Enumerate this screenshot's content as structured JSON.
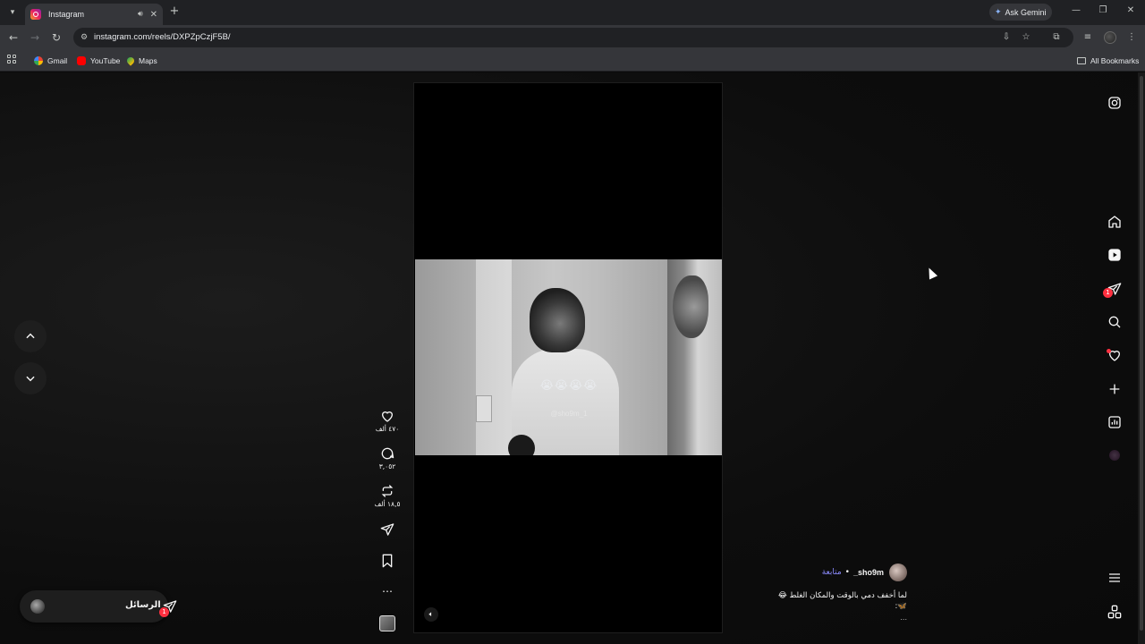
{
  "browser": {
    "tab": {
      "title": "Instagram"
    },
    "ask_gemini": "Ask Gemini",
    "url": "instagram.com/reels/DXPZpCzjF5B/",
    "bookmarks": [
      {
        "label": "Gmail"
      },
      {
        "label": "YouTube"
      },
      {
        "label": "Maps"
      }
    ],
    "all_bookmarks": "All Bookmarks"
  },
  "reel": {
    "video": {
      "emojis": "😭😭😭😭",
      "watermark": "@sho9m_1"
    },
    "actions": {
      "likes": "٤٧٠ ألف",
      "comments": "٣,٠٥٢",
      "reposts": "١٨,٥ ألف"
    },
    "author": {
      "username": "sho9m_",
      "separator": "•",
      "follow_label": "متابعة"
    },
    "caption": "لما أخفف دمي بالوقت والمكان الغلط 😂",
    "caption_line2": "🦋:",
    "caption_more": "..."
  },
  "messages": {
    "label": "الرسائل",
    "badge": "1"
  },
  "sidebar": {
    "messages_badge": "1"
  },
  "colors": {
    "background": "#0a0a0a",
    "follow_link": "#8c8cff",
    "badge": "#ff3040"
  }
}
